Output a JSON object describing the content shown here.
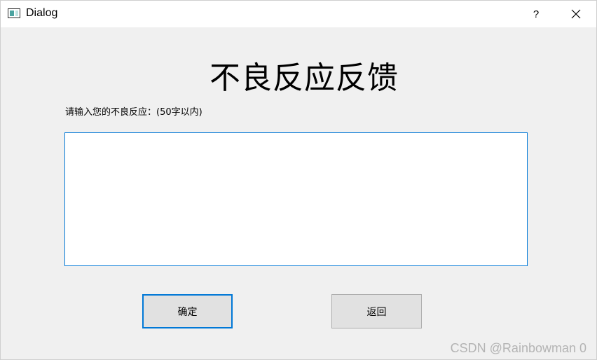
{
  "window": {
    "title": "Dialog",
    "help_label": "?",
    "icons": {
      "app": "window-app-icon",
      "close": "close-icon"
    }
  },
  "form": {
    "heading": "不良反应反馈",
    "prompt": "请输入您的不良反应：(50字以内)",
    "input_value": ""
  },
  "buttons": {
    "confirm": "确定",
    "back": "返回"
  },
  "watermark": "CSDN @Rainbowman 0",
  "colors": {
    "focus_border": "#0078d7",
    "dialog_bg": "#f0f0f0",
    "button_bg": "#e1e1e1"
  }
}
